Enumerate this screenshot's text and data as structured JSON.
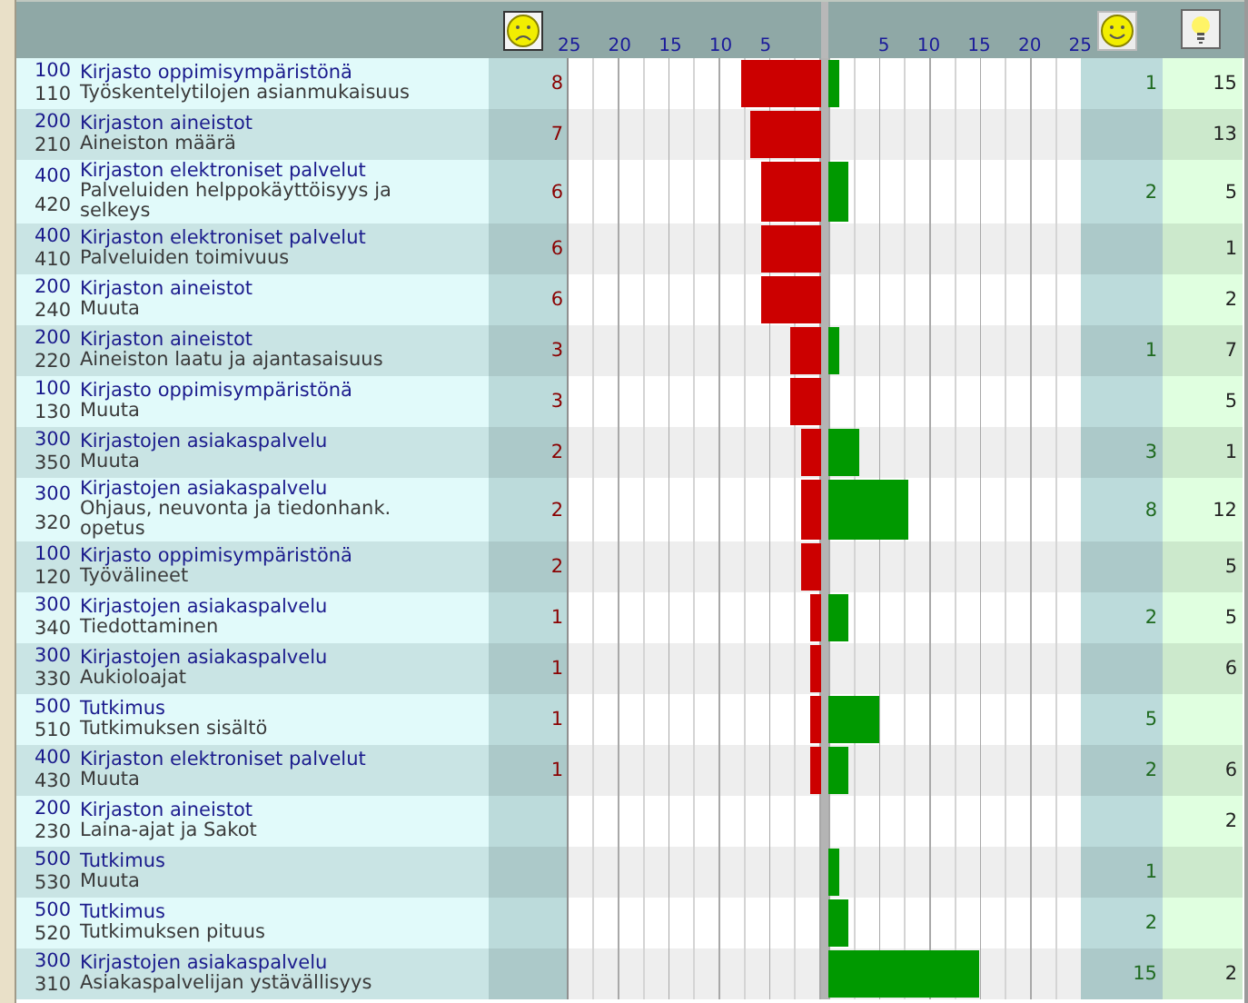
{
  "axis": {
    "negative_ticks": [
      "25",
      "20",
      "15",
      "10",
      "5"
    ],
    "positive_ticks": [
      "5",
      "10",
      "15",
      "20",
      "25"
    ]
  },
  "rows": [
    {
      "category_code": "100",
      "category": "Kirjasto oppimisympäristönä",
      "topic_code": "110",
      "topic": "Työskentelytilojen asianmukaisuus",
      "negative": "8",
      "positive": "1",
      "ideas": "15",
      "negative_bar": {
        "level": 0.32
      },
      "positive_bar": {
        "level": 0.04
      }
    },
    {
      "category_code": "200",
      "category": "Kirjaston aineistot",
      "topic_code": "210",
      "topic": "Aineiston määrä",
      "negative": "7",
      "ideas": "13",
      "negative_bar": {
        "level": 0.28
      }
    },
    {
      "category_code": "400",
      "category": "Kirjaston elektroniset palvelut",
      "topic_code": "420",
      "topic": "Palveluiden helppokäyttöisyys ja selkeys",
      "negative": "6",
      "positive": "2",
      "ideas": "5",
      "negative_bar": {
        "level": 0.24
      },
      "positive_bar": {
        "level": 0.08
      }
    },
    {
      "category_code": "400",
      "category": "Kirjaston elektroniset palvelut",
      "topic_code": "410",
      "topic": "Palveluiden toimivuus",
      "negative": "6",
      "ideas": "1",
      "negative_bar": {
        "level": 0.24
      }
    },
    {
      "category_code": "200",
      "category": "Kirjaston aineistot",
      "topic_code": "240",
      "topic": "Muuta",
      "negative": "6",
      "ideas": "2",
      "negative_bar": {
        "level": 0.24
      }
    },
    {
      "category_code": "200",
      "category": "Kirjaston aineistot",
      "topic_code": "220",
      "topic": "Aineiston laatu ja ajantasaisuus",
      "negative": "3",
      "positive": "1",
      "ideas": "7",
      "negative_bar": {
        "level": 0.12
      },
      "positive_bar": {
        "level": 0.04
      }
    },
    {
      "category_code": "100",
      "category": "Kirjasto oppimisympäristönä",
      "topic_code": "130",
      "topic": "Muuta",
      "negative": "3",
      "ideas": "5",
      "negative_bar": {
        "level": 0.12
      }
    },
    {
      "category_code": "300",
      "category": "Kirjastojen asiakaspalvelu",
      "topic_code": "350",
      "topic": "Muuta",
      "negative": "2",
      "positive": "3",
      "ideas": "1",
      "negative_bar": {
        "level": 0.08
      },
      "positive_bar": {
        "level": 0.12
      }
    },
    {
      "category_code": "300",
      "category": "Kirjastojen asiakaspalvelu",
      "topic_code": "320",
      "topic": "Ohjaus, neuvonta ja tiedonhank. opetus",
      "negative": "2",
      "positive": "8",
      "ideas": "12",
      "negative_bar": {
        "level": 0.08
      },
      "positive_bar": {
        "level": 0.32
      }
    },
    {
      "category_code": "100",
      "category": "Kirjasto oppimisympäristönä",
      "topic_code": "120",
      "topic": "Työvälineet",
      "negative": "2",
      "ideas": "5",
      "negative_bar": {
        "level": 0.08
      }
    },
    {
      "category_code": "300",
      "category": "Kirjastojen asiakaspalvelu",
      "topic_code": "340",
      "topic": "Tiedottaminen",
      "negative": "1",
      "positive": "2",
      "ideas": "5",
      "negative_bar": {
        "level": 0.04
      },
      "positive_bar": {
        "level": 0.08
      }
    },
    {
      "category_code": "300",
      "category": "Kirjastojen asiakaspalvelu",
      "topic_code": "330",
      "topic": "Aukioloajat",
      "negative": "1",
      "ideas": "6",
      "negative_bar": {
        "level": 0.04
      }
    },
    {
      "category_code": "500",
      "category": "Tutkimus",
      "topic_code": "510",
      "topic": "Tutkimuksen sisältö",
      "negative": "1",
      "positive": "5",
      "negative_bar": {
        "level": 0.04
      },
      "positive_bar": {
        "level": 0.2
      }
    },
    {
      "category_code": "400",
      "category": "Kirjaston elektroniset palvelut",
      "topic_code": "430",
      "topic": "Muuta",
      "negative": "1",
      "positive": "2",
      "ideas": "6",
      "negative_bar": {
        "level": 0.04
      },
      "positive_bar": {
        "level": 0.08
      }
    },
    {
      "category_code": "200",
      "category": "Kirjaston aineistot",
      "topic_code": "230",
      "topic": "Laina-ajat ja Sakot",
      "ideas": "2"
    },
    {
      "category_code": "500",
      "category": "Tutkimus",
      "topic_code": "530",
      "topic": "Muuta",
      "positive": "1",
      "positive_bar": {
        "level": 0.04
      }
    },
    {
      "category_code": "500",
      "category": "Tutkimus",
      "topic_code": "520",
      "topic": "Tutkimuksen pituus",
      "positive": "2",
      "positive_bar": {
        "level": 0.08
      }
    },
    {
      "category_code": "300",
      "category": "Kirjastojen asiakaspalvelu",
      "topic_code": "310",
      "topic": "Asiakaspalvelijan ystävällisyys",
      "positive": "15",
      "ideas": "2",
      "positive_bar": {
        "level": 0.6
      }
    }
  ]
}
